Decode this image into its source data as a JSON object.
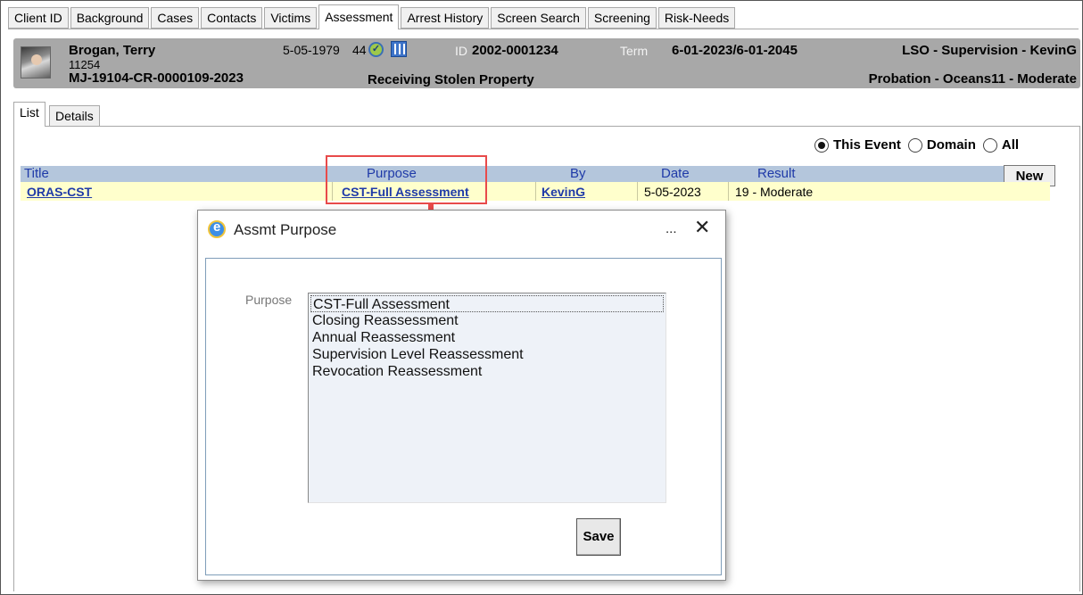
{
  "tabs": [
    {
      "label": "Client ID",
      "active": false
    },
    {
      "label": "Background",
      "active": false
    },
    {
      "label": "Cases",
      "active": false
    },
    {
      "label": "Contacts",
      "active": false
    },
    {
      "label": "Victims",
      "active": false
    },
    {
      "label": "Assessment",
      "active": true
    },
    {
      "label": "Arrest History",
      "active": false
    },
    {
      "label": "Screen Search",
      "active": false
    },
    {
      "label": "Screening",
      "active": false
    },
    {
      "label": "Risk-Needs",
      "active": false
    }
  ],
  "header": {
    "name": "Brogan, Terry",
    "number": "11254",
    "case_number": "MJ-19104-CR-0000109-2023",
    "dob": "5-05-1979",
    "age": "44",
    "id_label": "ID",
    "id_value": "2002-0001234",
    "term_label": "Term",
    "term_value": "6-01-2023/6-01-2045",
    "lso": "LSO - Supervision - KevinG",
    "offense": "Receiving Stolen Property",
    "probation": "Probation - Oceans11 - Moderate",
    "check_icon": "check-circle-icon",
    "bars_icon": "columns-icon"
  },
  "subtabs": [
    {
      "label": "List",
      "active": true
    },
    {
      "label": "Details",
      "active": false
    }
  ],
  "filter": {
    "options": [
      {
        "label": "This Event",
        "selected": true
      },
      {
        "label": "Domain",
        "selected": false
      },
      {
        "label": "All",
        "selected": false
      }
    ]
  },
  "grid": {
    "headers": {
      "title": "Title",
      "purpose": "Purpose",
      "by": "By",
      "date": "Date",
      "result": "Result"
    },
    "new_label": "New",
    "row": {
      "title": "ORAS-CST",
      "purpose": "CST-Full Assessment",
      "by": "KevinG",
      "date": "5-05-2023",
      "result": "19 - Moderate"
    }
  },
  "dialog": {
    "title": "Assmt Purpose",
    "more": "...",
    "close": "✕",
    "purpose_label": "Purpose",
    "options": [
      "CST-Full Assessment",
      "Closing Reassessment",
      "Annual Reassessment",
      "Supervision Level Reassessment",
      "Revocation Reassessment"
    ],
    "selected_index": 0,
    "save_label": "Save"
  },
  "colors": {
    "header_bg": "#a8a8a8",
    "grid_header_bg": "#b4c6dc",
    "row_bg": "#ffffcc",
    "link": "#1f3aa8",
    "annotation": "#e84a4a"
  }
}
